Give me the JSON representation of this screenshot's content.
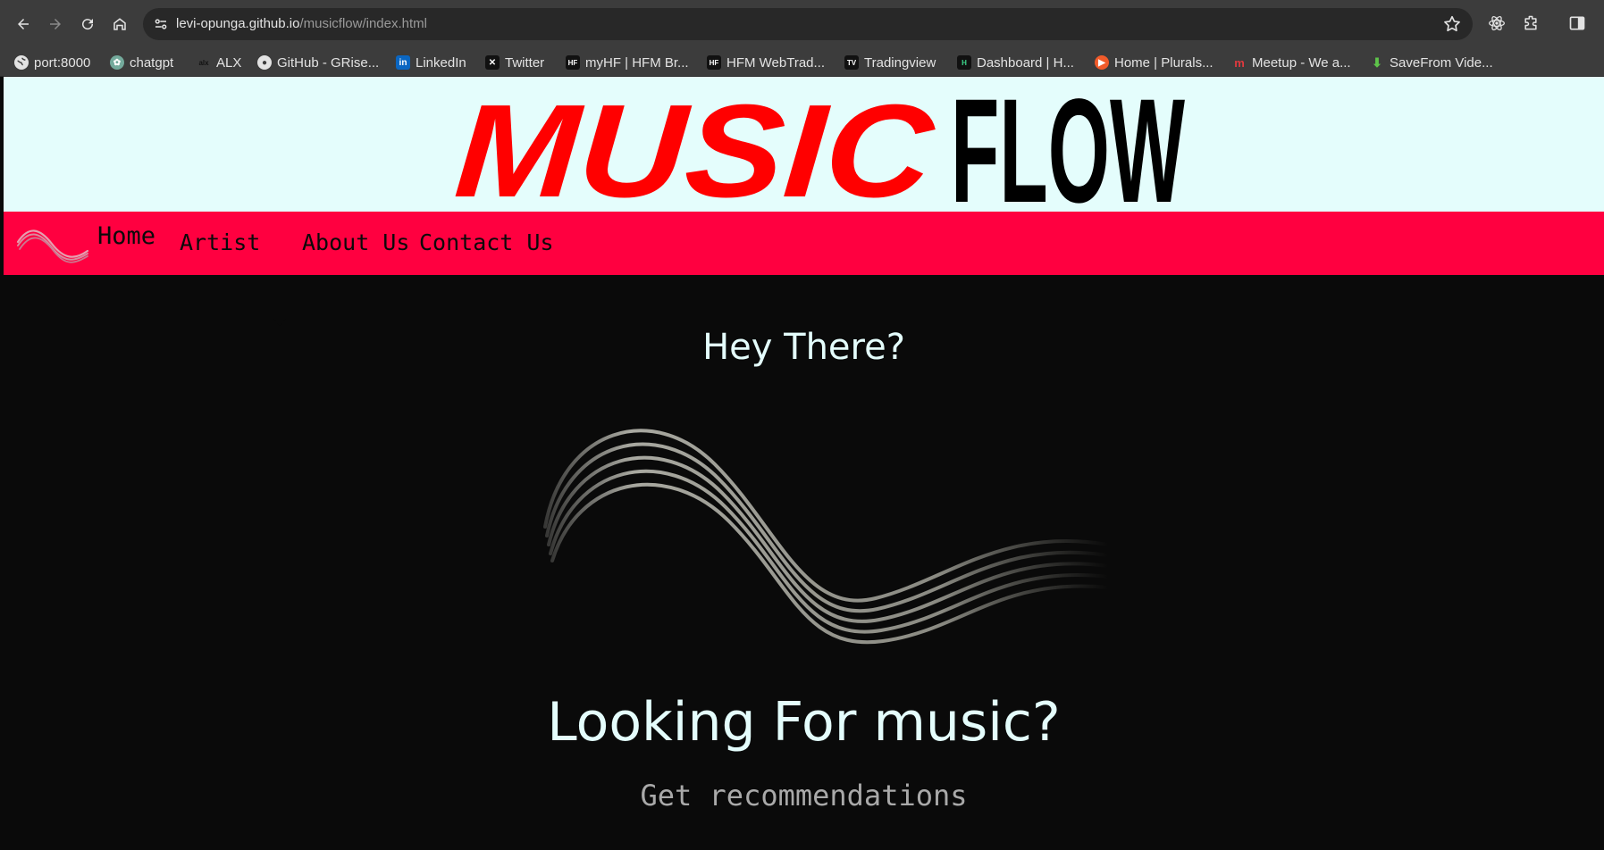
{
  "browser": {
    "url_host": "levi-opunga.github.io",
    "url_path": "/musicflow/index.html",
    "bookmarks": [
      {
        "label": "port:8000",
        "icon": "globe-icon"
      },
      {
        "label": "chatgpt",
        "icon": "chatgpt-icon"
      },
      {
        "label": "ALX",
        "icon": "alx-icon"
      },
      {
        "label": "GitHub - GRise...",
        "icon": "github-icon"
      },
      {
        "label": "LinkedIn",
        "icon": "linkedin-icon"
      },
      {
        "label": "Twitter",
        "icon": "x-icon"
      },
      {
        "label": "myHF | HFM Br...",
        "icon": "hf-icon"
      },
      {
        "label": "HFM WebTrad...",
        "icon": "hf-icon"
      },
      {
        "label": "Tradingview",
        "icon": "tradingview-icon"
      },
      {
        "label": "Dashboard | H...",
        "icon": "dashboard-icon"
      },
      {
        "label": "Home | Plurals...",
        "icon": "pluralsight-icon"
      },
      {
        "label": "Meetup - We a...",
        "icon": "meetup-icon"
      },
      {
        "label": "SaveFrom Vide...",
        "icon": "download-icon"
      }
    ]
  },
  "site": {
    "logo_word1": "MUSIC",
    "logo_word2": "FLOW",
    "nav": {
      "home": "Home",
      "artist": "Artist",
      "about": "About Us",
      "contact": "Contact Us"
    },
    "greeting": "Hey There?",
    "headline": "Looking For music?",
    "subline": "Get recommendations"
  },
  "colors": {
    "header_bg": "#e4fdfc",
    "nav_bg": "#ff0040",
    "logo_red": "#ff0000",
    "page_bg": "#0a0a0a"
  }
}
